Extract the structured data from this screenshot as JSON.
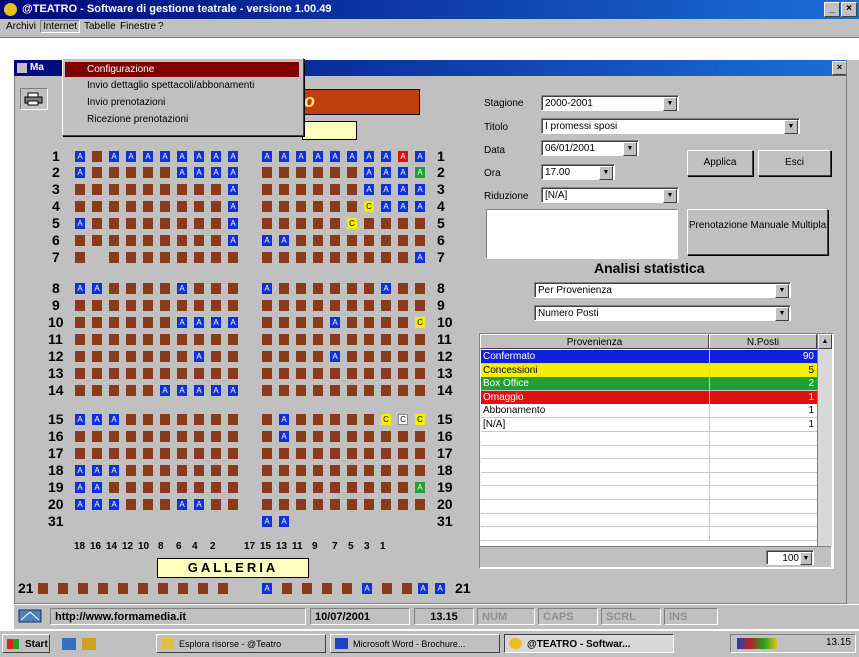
{
  "window": {
    "title": "@TEATRO - Software di gestione teatrale - versione 1.00.49",
    "controls": [
      "_",
      "×"
    ]
  },
  "menubar": [
    "Archivi",
    "Internet",
    "Tabelle",
    "Finestre",
    "?"
  ],
  "menu_open": {
    "items": [
      "Configurazione",
      "Invio dettaglio spettacoli/abbonamenti",
      "Invio prenotazioni",
      "Ricezione prenotazioni"
    ],
    "selected": 0
  },
  "child": {
    "title": "Ma",
    "close": "×",
    "title_banner_fragment": "o"
  },
  "form": {
    "stagione": {
      "label": "Stagione",
      "value": "2000-2001"
    },
    "titolo": {
      "label": "Titolo",
      "value": "I promessi sposi"
    },
    "data": {
      "label": "Data",
      "value": "06/01/2001"
    },
    "ora": {
      "label": "Ora",
      "value": "17.00"
    },
    "riduzione": {
      "label": "Riduzione",
      "value": "[N/A]"
    },
    "applica": "Applica",
    "esci": "Esci",
    "prenotazione": "Prenotazione Manuale Multipla"
  },
  "stats": {
    "heading": "Analisi statistica",
    "filter1": "Per Provenienza",
    "filter2": "Numero Posti",
    "columns": [
      "Provenienza",
      "N.Posti"
    ],
    "rows": [
      {
        "name": "Confermato",
        "value": "90",
        "color": "#1020d8",
        "text": "#ffffff"
      },
      {
        "name": "Concessioni",
        "value": "5",
        "color": "#f4f000",
        "text": "#000000"
      },
      {
        "name": "Box Office",
        "value": "2",
        "color": "#20a030",
        "text": "#ffffff"
      },
      {
        "name": "Omaggio",
        "value": "1",
        "color": "#e01010",
        "text": "#ffffff"
      },
      {
        "name": "Abbonamento",
        "value": "1",
        "color": "#ffffff",
        "text": "#000000"
      },
      {
        "name": "[N/A]",
        "value": "1",
        "color": "#ffffff",
        "text": "#000000"
      }
    ],
    "zoom": "100"
  },
  "seating": {
    "rows_left": [
      "1",
      "2",
      "3",
      "4",
      "5",
      "6",
      "7",
      "8",
      "9",
      "10",
      "11",
      "12",
      "13",
      "14",
      "15",
      "16",
      "17",
      "18",
      "19",
      "20",
      "31"
    ],
    "rows_right": [
      "1",
      "2",
      "3",
      "4",
      "5",
      "6",
      "7",
      "8",
      "9",
      "10",
      "11",
      "12",
      "13",
      "14",
      "15",
      "16",
      "17",
      "18",
      "19",
      "20",
      "31"
    ],
    "columns": [
      "18",
      "16",
      "14",
      "12",
      "10",
      "8",
      "6",
      "4",
      "2",
      "17",
      "15",
      "13",
      "11",
      "9",
      "7",
      "5",
      "3",
      "1"
    ],
    "galleria": "GALLERIA",
    "row21": "21"
  },
  "statusbar": {
    "url": "http://www.formamedia.it",
    "date": "10/07/2001",
    "time": "13.15",
    "keys": [
      "NUM",
      "CAPS",
      "SCRL",
      "INS"
    ]
  },
  "taskbar": {
    "start": "Start",
    "tasks": [
      "Esplora risorse - @Teatro",
      "Microsoft Word - Brochure...",
      "@TEATRO - Softwar..."
    ],
    "clock": "13.15"
  }
}
